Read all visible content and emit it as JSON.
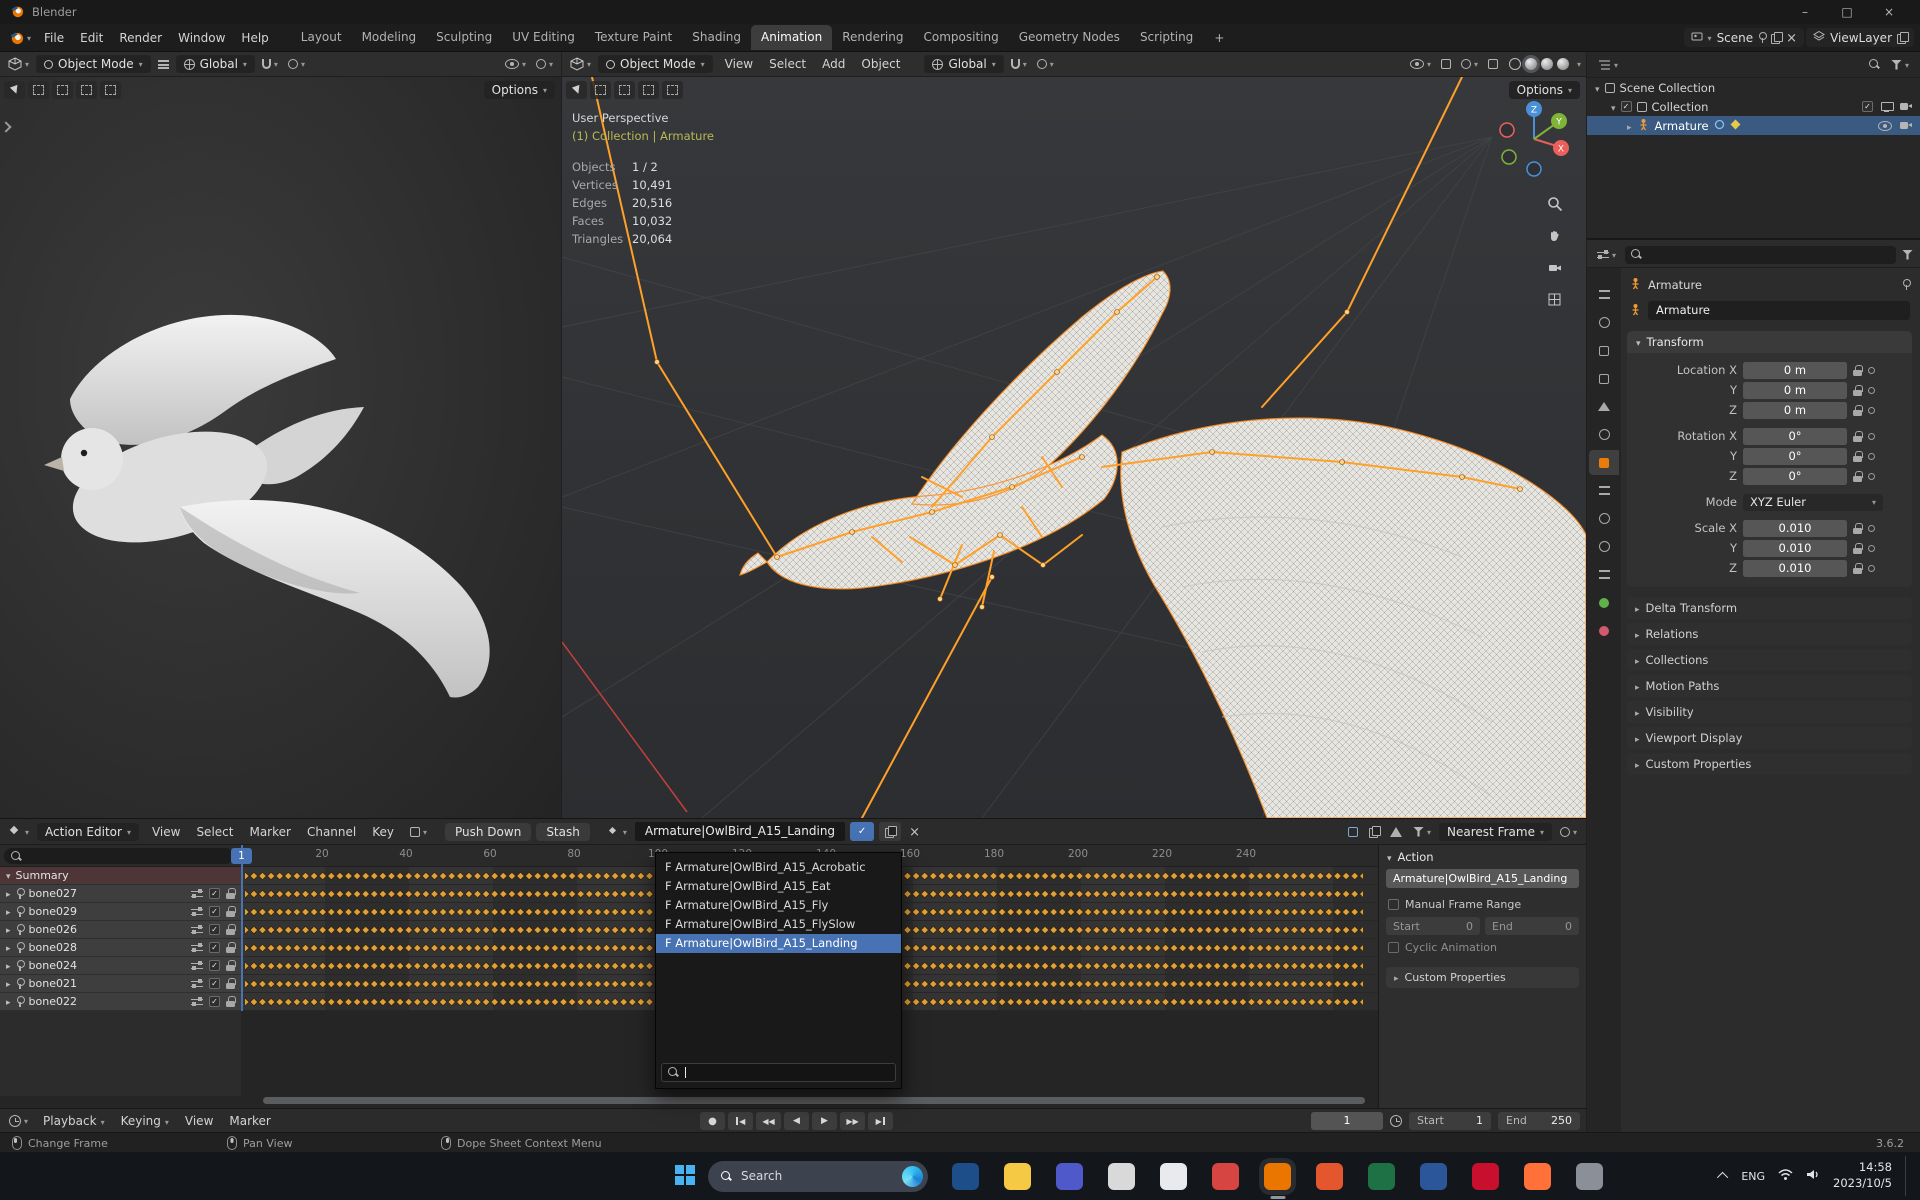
{
  "window": {
    "title": "Blender",
    "controls": {
      "minimize": "–",
      "maximize": "□",
      "close": "×"
    }
  },
  "topbar": {
    "menus": [
      "File",
      "Edit",
      "Render",
      "Window",
      "Help"
    ],
    "workspaces": [
      "Layout",
      "Modeling",
      "Sculpting",
      "UV Editing",
      "Texture Paint",
      "Shading",
      "Animation",
      "Rendering",
      "Compositing",
      "Geometry Nodes",
      "Scripting"
    ],
    "active_workspace": "Animation",
    "add_workspace_label": "+",
    "scene_label": "Scene",
    "viewlayer_label": "ViewLayer"
  },
  "viewport_left": {
    "mode": "Object Mode",
    "orientation": "Global",
    "options_label": "Options"
  },
  "viewport_right": {
    "mode": "Object Mode",
    "menus": [
      "View",
      "Select",
      "Add",
      "Object"
    ],
    "orientation": "Global",
    "options_label": "Options",
    "overlay": {
      "view_name": "User Perspective",
      "context_path": "(1) Collection | Armature",
      "stats": [
        {
          "label": "Objects",
          "value": "1 / 2"
        },
        {
          "label": "Vertices",
          "value": "10,491"
        },
        {
          "label": "Edges",
          "value": "20,516"
        },
        {
          "label": "Faces",
          "value": "10,032"
        },
        {
          "label": "Triangles",
          "value": "20,064"
        }
      ]
    },
    "gizmo": {
      "x": "X",
      "y": "Y",
      "z": "Z"
    }
  },
  "outliner": {
    "scene_collection": "Scene Collection",
    "collection": "Collection",
    "armature": "Armature"
  },
  "properties": {
    "breadcrumb_object": "Armature",
    "object_name": "Armature",
    "transform_header": "Transform",
    "location_rows": [
      {
        "label": "Location X",
        "value": "0 m"
      },
      {
        "label": "Y",
        "value": "0 m"
      },
      {
        "label": "Z",
        "value": "0 m"
      }
    ],
    "rotation_rows": [
      {
        "label": "Rotation X",
        "value": "0°"
      },
      {
        "label": "Y",
        "value": "0°"
      },
      {
        "label": "Z",
        "value": "0°"
      }
    ],
    "mode_label": "Mode",
    "mode_value": "XYZ Euler",
    "scale_rows": [
      {
        "label": "Scale X",
        "value": "0.010"
      },
      {
        "label": "Y",
        "value": "0.010"
      },
      {
        "label": "Z",
        "value": "0.010"
      }
    ],
    "sections": [
      "Delta Transform",
      "Relations",
      "Collections",
      "Motion Paths",
      "Visibility",
      "Viewport Display",
      "Custom Properties"
    ]
  },
  "dopesheet": {
    "editor_label": "Action Editor",
    "menus": [
      "View",
      "Select",
      "Marker",
      "Channel",
      "Key"
    ],
    "push_down_label": "Push Down",
    "stash_label": "Stash",
    "action_name": "Armature|OwlBird_A15_Landing",
    "snap_label": "Nearest Frame",
    "current_frame": "1",
    "ruler_ticks": [
      "20",
      "40",
      "60",
      "80",
      "100",
      "120",
      "140",
      "160",
      "180",
      "200",
      "220",
      "240"
    ],
    "channels": [
      "Summary",
      "bone027",
      "bone029",
      "bone026",
      "bone028",
      "bone024",
      "bone021",
      "bone022"
    ],
    "dropdown_items": [
      "F Armature|OwlBird_A15_Acrobatic",
      "F Armature|OwlBird_A15_Eat",
      "F Armature|OwlBird_A15_Fly",
      "F Armature|OwlBird_A15_FlySlow",
      "F Armature|OwlBird_A15_Landing"
    ],
    "dropdown_selected": "F Armature|OwlBird_A15_Landing"
  },
  "action_panel": {
    "header": "Action",
    "action_name": "Armature|OwlBird_A15_Landing",
    "manual_frame_range_label": "Manual Frame Range",
    "start_label": "Start",
    "start_value": "0",
    "end_label": "End",
    "end_value": "0",
    "cyclic_label": "Cyclic Animation",
    "custom_properties_label": "Custom Properties"
  },
  "playback": {
    "menus": [
      "Playback",
      "Keying",
      "View",
      "Marker"
    ],
    "frame_value": "1",
    "start_label": "Start",
    "start_value": "1",
    "end_label": "End",
    "end_value": "250"
  },
  "statusbar": {
    "change_frame": "Change Frame",
    "pan_view": "Pan View",
    "context_menu": "Dope Sheet Context Menu",
    "version": "3.6.2"
  },
  "taskbar": {
    "search_placeholder": "Search",
    "language": "ENG",
    "time": "14:58",
    "date": "2023/10/5",
    "apps": [
      {
        "name": "app-blue",
        "color": "#1d4e89"
      },
      {
        "name": "app-folder",
        "color": "#f6c944"
      },
      {
        "name": "app-teams",
        "color": "#5059c9"
      },
      {
        "name": "app-light",
        "color": "#d9d9d9"
      },
      {
        "name": "app-chrome",
        "color": "#e8eaed"
      },
      {
        "name": "app-red",
        "color": "#d64541"
      },
      {
        "name": "app-blender",
        "color": "#ea7600"
      },
      {
        "name": "app-orange",
        "color": "#e4572e"
      },
      {
        "name": "app-green",
        "color": "#1e7145"
      },
      {
        "name": "app-navy",
        "color": "#2b579a"
      },
      {
        "name": "app-adobe",
        "color": "#c8102e"
      },
      {
        "name": "app-firefox",
        "color": "#ff7139"
      },
      {
        "name": "app-gray",
        "color": "#8a8f98"
      }
    ]
  },
  "colors": {
    "accent": "#4772b3",
    "blender_orange": "#e87d0d",
    "keyframe": "#dfa23a",
    "armature": "#ffa028"
  }
}
